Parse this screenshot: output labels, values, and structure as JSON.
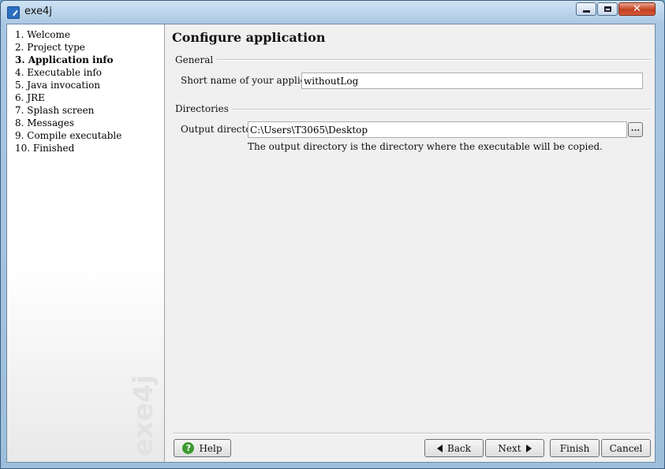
{
  "window": {
    "title": "exe4j",
    "icon": "exe4j-app-icon"
  },
  "sidebar": {
    "steps": [
      {
        "label": "1. Welcome",
        "active": false
      },
      {
        "label": "2. Project type",
        "active": false
      },
      {
        "label": "3. Application info",
        "active": true
      },
      {
        "label": "4. Executable info",
        "active": false
      },
      {
        "label": "5. Java invocation",
        "active": false
      },
      {
        "label": "6. JRE",
        "active": false
      },
      {
        "label": "7. Splash screen",
        "active": false
      },
      {
        "label": "8. Messages",
        "active": false
      },
      {
        "label": "9. Compile executable",
        "active": false
      },
      {
        "label": "10. Finished",
        "active": false
      }
    ],
    "watermark": "exe4j"
  },
  "main": {
    "title": "Configure application",
    "general": {
      "label": "General",
      "short_name_label": "Short name of your application:",
      "short_name_value": "withoutLog"
    },
    "directories": {
      "label": "Directories",
      "output_label": "Output directory:",
      "output_value": "C:\\Users\\T3065\\Desktop",
      "browse_label": "...",
      "hint": "The output directory is the directory where the executable will be copied."
    }
  },
  "buttons": {
    "help": "Help",
    "back": "Back",
    "next": "Next",
    "finish": "Finish",
    "cancel": "Cancel"
  }
}
